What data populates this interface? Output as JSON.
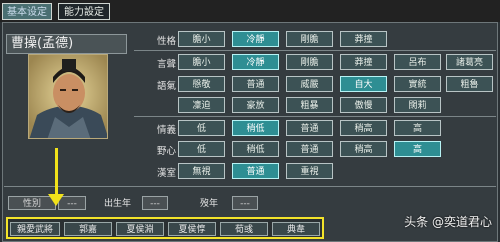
{
  "tabs": [
    {
      "label": "基本设定",
      "active": true
    },
    {
      "label": "能力設定",
      "active": false
    }
  ],
  "character": {
    "name": "曹操(孟德)"
  },
  "rows": [
    {
      "label": "性格",
      "options": [
        "膽小",
        "冷靜",
        "剛膽",
        "莽撞"
      ],
      "selected": [
        1
      ]
    },
    {
      "label": "言聲",
      "options": [
        "膽小",
        "冷靜",
        "剛膽",
        "莽撞",
        "呂布",
        "諸葛亮"
      ],
      "selected": [
        1
      ]
    },
    {
      "label": "語氣",
      "options": [
        "慇敬",
        "普通",
        "威嚴",
        "自大",
        "實統",
        "粗魯"
      ],
      "selected": [
        3
      ]
    },
    {
      "label": "",
      "options": [
        "凜迫",
        "豪放",
        "粗暴",
        "傲慢",
        "闊莉"
      ],
      "selected": []
    },
    {
      "label": "情義",
      "options": [
        "低",
        "稍低",
        "普通",
        "稍高",
        "高"
      ],
      "selected": [
        1
      ]
    },
    {
      "label": "野心",
      "options": [
        "低",
        "稍低",
        "普通",
        "稍高",
        "高"
      ],
      "selected": [
        4
      ]
    },
    {
      "label": "漢室",
      "options": [
        "無視",
        "普通",
        "重視"
      ],
      "selected": [
        1
      ]
    }
  ],
  "bottom": {
    "field1_label": "性別",
    "field1_value": "---",
    "birth_label": "出生年",
    "birth_value": "---",
    "death_label": "歿年",
    "death_value": "---"
  },
  "relations": [
    "親愛武將",
    "郭嘉",
    "夏侯淵",
    "夏侯惇",
    "荀彧",
    "典韋"
  ],
  "watermark": "头条 @奕道君心",
  "colors": {
    "highlight": "#f3e32a",
    "selected": "#2e8e93"
  }
}
